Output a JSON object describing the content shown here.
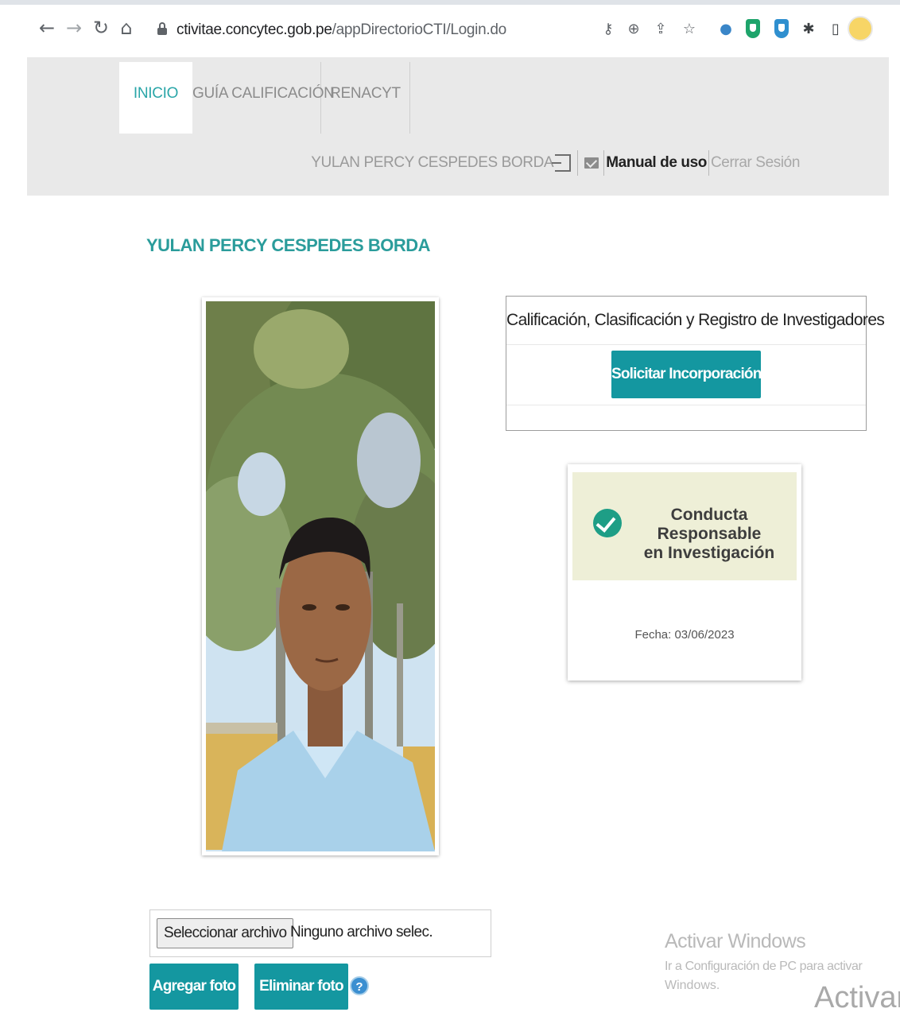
{
  "browser": {
    "url_domain": "ctivitae.concytec.gob.pe",
    "url_path": "/appDirectorioCTI/Login.do"
  },
  "header": {
    "tabs": [
      {
        "label": "INICIO",
        "active": true
      },
      {
        "label": "GUÍA CALIFICACIÓN",
        "active": false
      },
      {
        "label": "RENACYT",
        "active": false
      }
    ],
    "user_name": "YULAN PERCY CESPEDES BORDA",
    "manual_label": "Manual de uso",
    "logout_label": "Cerrar Sesión"
  },
  "profile": {
    "title": "YULAN PERCY CESPEDES BORDA"
  },
  "renacyt_card": {
    "title": "Calificación, Clasificación y Registro de Investigadores",
    "button_label": "Solicitar Incorporación"
  },
  "conducta_card": {
    "line1": "Conducta Responsable",
    "line2": "en Investigación",
    "fecha": "Fecha: 03/06/2023"
  },
  "upload": {
    "select_label": "Seleccionar archivo",
    "status": "Ninguno archivo selec.",
    "add_label": "Agregar foto",
    "delete_label": "Eliminar foto",
    "help_glyph": "?"
  },
  "watermark": {
    "line1": "Activar Windows",
    "line2": "Ir a Configuración de PC para activar",
    "line3": "Windows.",
    "overflow": "Activar"
  },
  "colors": {
    "accent": "#1497a0",
    "title_teal": "#2a9c9b",
    "header_bg": "#e9e9e9",
    "conducta_bg": "#eeefd7"
  }
}
